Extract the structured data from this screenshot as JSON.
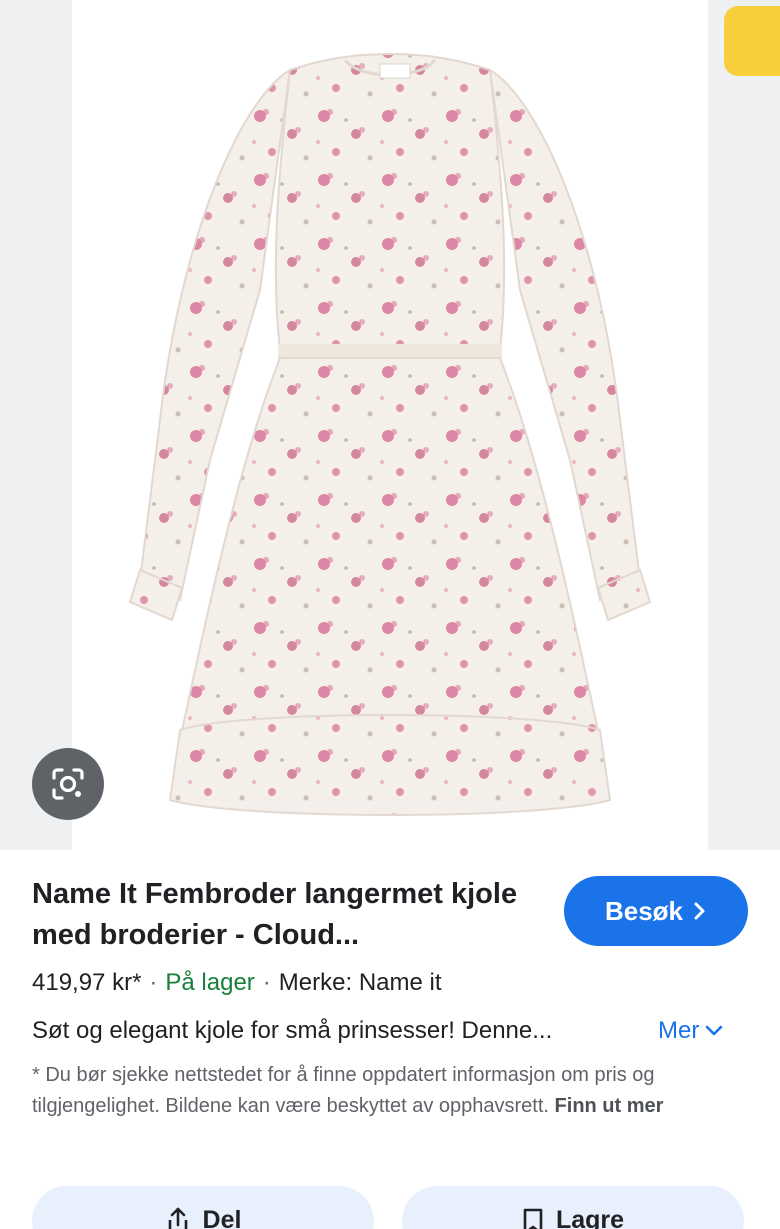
{
  "product": {
    "title": "Name It Fembroder langermet kjole med broderier - Cloud...",
    "price": "419,97 kr*",
    "separator": "·",
    "stock": "På lager",
    "brand": "Merke: Name it",
    "description": "Søt og elegant kjole for små prinsesser! Denne...",
    "more_label": "Mer"
  },
  "actions": {
    "visit_label": "Besøk",
    "share_label": "Del",
    "save_label": "Lagre"
  },
  "notice": {
    "text": "* Du bør sjekke nettstedet for å finne oppdatert informasjon om pris og tilgjengelighet. Bildene kan være beskyttet av opphavsrett.",
    "link": "Finn ut mer"
  },
  "icons": {
    "lens": "lens-search-icon",
    "visit_arrow": "chevron-right-icon",
    "more_arrow": "chevron-down-icon",
    "share": "share-icon",
    "save": "bookmark-icon"
  },
  "colors": {
    "accent": "#1a73e8",
    "stock": "#188038",
    "action_bg": "#e8f0fe",
    "dress_base": "#f4efe9",
    "flower": "#d4648e"
  }
}
